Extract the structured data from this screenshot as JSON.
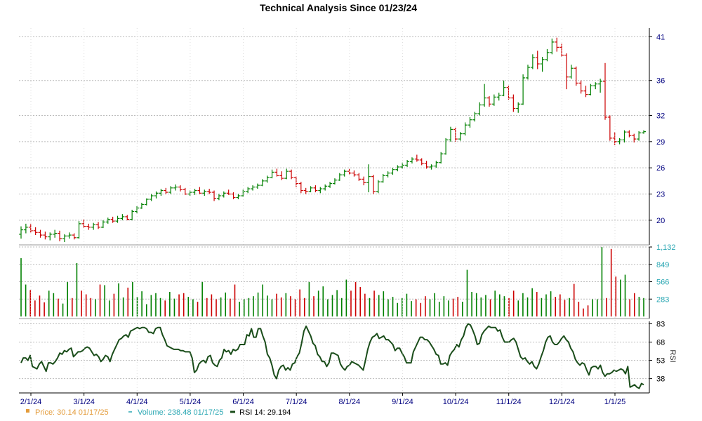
{
  "chart_data": {
    "type": "candlestick",
    "title": "Technical Analysis Since 01/23/24",
    "x_tick_labels": [
      "2/1/24",
      "3/1/24",
      "4/1/24",
      "5/1/24",
      "6/1/24",
      "7/1/24",
      "8/1/24",
      "9/1/24",
      "10/1/24",
      "11/1/24",
      "12/1/24",
      "1/1/25"
    ],
    "grid": true,
    "colors": {
      "up": "#008000",
      "down": "#cc0000",
      "rsi": "#1a4d1a",
      "price_legend": "#e39b3a",
      "volume_legend": "#2aa7b3",
      "grid": "#bbbbbb"
    },
    "price_panel": {
      "y_ticks": [
        20,
        23,
        26,
        29,
        32,
        36,
        41
      ],
      "ylim": [
        17.5,
        42
      ],
      "axis_color": "#000080",
      "ohlc": [
        [
          18.4,
          19.3,
          17.9,
          18.9
        ],
        [
          18.9,
          19.6,
          18.5,
          19.2
        ],
        [
          19.2,
          19.6,
          18.6,
          18.8
        ],
        [
          18.8,
          19.2,
          18.3,
          18.6
        ],
        [
          18.6,
          18.9,
          18.0,
          18.3
        ],
        [
          18.3,
          18.7,
          17.8,
          18.1
        ],
        [
          18.1,
          18.6,
          17.7,
          18.4
        ],
        [
          18.4,
          18.9,
          18.0,
          18.5
        ],
        [
          18.5,
          18.8,
          17.6,
          17.9
        ],
        [
          17.9,
          18.4,
          17.5,
          18.2
        ],
        [
          18.2,
          18.6,
          17.9,
          18.3
        ],
        [
          18.3,
          18.5,
          17.8,
          18.0
        ],
        [
          18.0,
          19.9,
          17.9,
          19.6
        ],
        [
          19.6,
          20.1,
          19.1,
          19.3
        ],
        [
          19.3,
          19.6,
          18.9,
          19.2
        ],
        [
          19.2,
          19.7,
          18.9,
          19.5
        ],
        [
          19.5,
          19.8,
          19.0,
          19.2
        ],
        [
          19.2,
          20.0,
          19.1,
          19.8
        ],
        [
          19.8,
          20.3,
          19.6,
          20.1
        ],
        [
          20.1,
          20.4,
          19.7,
          19.9
        ],
        [
          19.9,
          20.5,
          19.7,
          20.2
        ],
        [
          20.2,
          20.7,
          20.0,
          20.4
        ],
        [
          20.4,
          20.6,
          20.0,
          20.1
        ],
        [
          20.1,
          21.2,
          20.0,
          21.0
        ],
        [
          21.0,
          21.6,
          20.8,
          21.4
        ],
        [
          21.4,
          22.0,
          21.3,
          21.8
        ],
        [
          21.8,
          22.5,
          21.7,
          22.4
        ],
        [
          22.4,
          23.0,
          22.2,
          22.8
        ],
        [
          22.8,
          23.3,
          22.5,
          23.1
        ],
        [
          23.1,
          23.6,
          22.8,
          23.4
        ],
        [
          23.4,
          23.7,
          23.0,
          23.2
        ],
        [
          23.2,
          23.9,
          23.0,
          23.7
        ],
        [
          23.7,
          24.1,
          23.4,
          23.8
        ],
        [
          23.8,
          24.0,
          23.3,
          23.5
        ],
        [
          23.5,
          23.7,
          22.9,
          23.0
        ],
        [
          23.0,
          23.4,
          22.8,
          23.2
        ],
        [
          23.2,
          23.6,
          22.9,
          23.4
        ],
        [
          23.4,
          23.8,
          23.0,
          23.1
        ],
        [
          23.1,
          23.5,
          22.8,
          23.3
        ],
        [
          23.3,
          23.6,
          23.0,
          23.2
        ],
        [
          23.2,
          23.4,
          22.2,
          22.5
        ],
        [
          22.5,
          23.0,
          22.3,
          22.8
        ],
        [
          22.8,
          23.3,
          22.6,
          23.1
        ],
        [
          23.1,
          23.5,
          22.9,
          23.0
        ],
        [
          23.0,
          23.2,
          22.4,
          22.6
        ],
        [
          22.6,
          23.0,
          22.4,
          22.8
        ],
        [
          22.8,
          23.5,
          22.7,
          23.3
        ],
        [
          23.3,
          23.8,
          23.1,
          23.6
        ],
        [
          23.6,
          24.0,
          23.4,
          23.8
        ],
        [
          23.8,
          24.2,
          23.6,
          24.0
        ],
        [
          24.0,
          24.7,
          23.9,
          24.5
        ],
        [
          24.5,
          25.1,
          24.3,
          24.9
        ],
        [
          24.9,
          25.8,
          24.8,
          25.5
        ],
        [
          25.5,
          25.9,
          25.0,
          25.1
        ],
        [
          25.1,
          25.6,
          24.6,
          24.8
        ],
        [
          24.8,
          25.9,
          24.7,
          25.6
        ],
        [
          25.6,
          25.8,
          24.7,
          24.9
        ],
        [
          24.9,
          25.0,
          23.8,
          24.2
        ],
        [
          24.2,
          24.4,
          23.1,
          23.4
        ],
        [
          23.4,
          23.7,
          23.0,
          23.3
        ],
        [
          23.3,
          23.9,
          23.2,
          23.7
        ],
        [
          23.7,
          24.0,
          23.2,
          23.4
        ],
        [
          23.4,
          23.8,
          23.1,
          23.6
        ],
        [
          23.6,
          24.1,
          23.4,
          23.9
        ],
        [
          23.9,
          24.4,
          23.7,
          24.2
        ],
        [
          24.2,
          24.8,
          24.1,
          24.6
        ],
        [
          24.6,
          25.4,
          24.5,
          25.2
        ],
        [
          25.2,
          25.8,
          25.0,
          25.6
        ],
        [
          25.6,
          25.9,
          25.2,
          25.4
        ],
        [
          25.4,
          25.7,
          25.0,
          25.2
        ],
        [
          25.2,
          25.4,
          24.5,
          24.7
        ],
        [
          24.7,
          25.0,
          24.0,
          24.3
        ],
        [
          24.3,
          26.4,
          23.2,
          25.0
        ],
        [
          25.0,
          25.2,
          23.0,
          23.3
        ],
        [
          23.3,
          24.6,
          23.1,
          24.4
        ],
        [
          24.4,
          25.3,
          24.3,
          25.1
        ],
        [
          25.1,
          25.6,
          24.9,
          25.4
        ],
        [
          25.4,
          26.0,
          25.2,
          25.8
        ],
        [
          25.8,
          26.3,
          25.6,
          26.1
        ],
        [
          26.1,
          26.6,
          25.9,
          26.3
        ],
        [
          26.3,
          26.9,
          26.1,
          26.7
        ],
        [
          26.7,
          27.2,
          26.5,
          27.0
        ],
        [
          27.0,
          27.5,
          26.7,
          26.9
        ],
        [
          26.9,
          27.1,
          26.3,
          26.5
        ],
        [
          26.5,
          26.8,
          25.9,
          26.1
        ],
        [
          26.1,
          26.4,
          25.8,
          26.2
        ],
        [
          26.2,
          26.8,
          26.0,
          26.6
        ],
        [
          26.6,
          27.8,
          26.5,
          27.6
        ],
        [
          27.6,
          29.4,
          27.5,
          29.2
        ],
        [
          29.2,
          30.7,
          29.0,
          30.4
        ],
        [
          30.4,
          30.6,
          29.0,
          29.3
        ],
        [
          29.3,
          30.1,
          29.1,
          29.9
        ],
        [
          29.9,
          31.2,
          29.7,
          30.9
        ],
        [
          30.9,
          31.8,
          30.6,
          31.5
        ],
        [
          31.5,
          32.4,
          31.3,
          32.2
        ],
        [
          32.2,
          33.5,
          32.0,
          33.2
        ],
        [
          33.2,
          35.6,
          33.0,
          34.0
        ],
        [
          34.0,
          34.2,
          33.0,
          33.3
        ],
        [
          33.3,
          34.4,
          33.1,
          34.1
        ],
        [
          34.1,
          34.6,
          33.7,
          34.3
        ],
        [
          34.3,
          36.0,
          34.2,
          35.2
        ],
        [
          35.2,
          35.4,
          33.8,
          34.0
        ],
        [
          34.0,
          34.4,
          32.4,
          32.8
        ],
        [
          32.8,
          33.5,
          32.3,
          33.3
        ],
        [
          33.3,
          36.7,
          33.2,
          36.3
        ],
        [
          36.3,
          37.8,
          36.1,
          37.5
        ],
        [
          37.5,
          39.0,
          37.3,
          38.6
        ],
        [
          38.6,
          39.4,
          37.3,
          37.9
        ],
        [
          37.9,
          38.7,
          37.0,
          38.4
        ],
        [
          38.4,
          39.6,
          38.2,
          39.2
        ],
        [
          39.2,
          40.8,
          39.0,
          40.4
        ],
        [
          40.4,
          40.9,
          39.3,
          39.8
        ],
        [
          39.8,
          40.2,
          38.7,
          38.9
        ],
        [
          38.9,
          39.1,
          35.0,
          36.4
        ],
        [
          36.4,
          37.8,
          36.2,
          37.4
        ],
        [
          37.4,
          37.6,
          35.4,
          35.7
        ],
        [
          35.7,
          36.0,
          34.5,
          34.8
        ],
        [
          34.8,
          35.4,
          34.1,
          34.4
        ],
        [
          34.4,
          35.6,
          34.3,
          35.4
        ],
        [
          35.4,
          35.8,
          35.0,
          35.6
        ],
        [
          35.6,
          36.2,
          34.6,
          35.9
        ],
        [
          35.9,
          38.0,
          31.5,
          31.8
        ],
        [
          31.8,
          32.0,
          29.1,
          29.4
        ],
        [
          29.4,
          30.1,
          28.6,
          29.0
        ],
        [
          29.0,
          29.4,
          28.7,
          29.2
        ],
        [
          29.2,
          30.3,
          28.9,
          30.1
        ],
        [
          30.1,
          30.3,
          29.5,
          29.7
        ],
        [
          29.7,
          29.9,
          28.9,
          29.3
        ],
        [
          29.3,
          30.2,
          29.1,
          30.0
        ],
        [
          30.0,
          30.3,
          29.9,
          30.14
        ]
      ]
    },
    "volume_panel": {
      "y_ticks": [
        283,
        566,
        849,
        1132
      ],
      "y_tick_labels": [
        "283",
        "566",
        "849",
        "1,132"
      ],
      "ylim": [
        0,
        1132
      ],
      "axis_color": "#2aa7b3",
      "values": [
        950,
        520,
        430,
        260,
        340,
        230,
        420,
        380,
        290,
        210,
        560,
        300,
        870,
        420,
        360,
        300,
        280,
        520,
        510,
        260,
        370,
        540,
        310,
        470,
        560,
        320,
        410,
        200,
        350,
        380,
        300,
        260,
        400,
        290,
        360,
        380,
        320,
        280,
        240,
        560,
        300,
        360,
        280,
        310,
        390,
        290,
        520,
        240,
        280,
        300,
        330,
        390,
        520,
        340,
        280,
        370,
        310,
        380,
        330,
        280,
        440,
        300,
        560,
        330,
        420,
        490,
        280,
        350,
        430,
        300,
        600,
        420,
        560,
        480,
        370,
        300,
        420,
        350,
        410,
        280,
        320,
        220,
        300,
        370,
        250,
        280,
        220,
        330,
        280,
        380,
        240,
        330,
        260,
        290,
        320,
        240,
        760,
        400,
        380,
        310,
        350,
        280,
        420,
        360,
        330,
        300,
        420,
        260,
        380,
        310,
        460,
        400,
        300,
        360,
        410,
        320,
        360,
        270,
        300,
        530,
        240,
        130,
        180,
        280,
        280,
        1130,
        300,
        1100,
        650,
        600,
        680,
        280,
        380,
        320,
        300
      ]
    },
    "rsi_panel": {
      "y_ticks": [
        38,
        53,
        68,
        83
      ],
      "axis_label": "RSI",
      "axis_color": "#000000",
      "ylim": [
        28,
        85
      ],
      "values": [
        51,
        55,
        55,
        53,
        57,
        48,
        47,
        46,
        50,
        52,
        48,
        44,
        51,
        51,
        50,
        52,
        55,
        59,
        58,
        61,
        60,
        62,
        63,
        56,
        58,
        60,
        60,
        61,
        63,
        64,
        63,
        60,
        57,
        58,
        56,
        52,
        54,
        57,
        56,
        52,
        58,
        62,
        66,
        70,
        71,
        73,
        74,
        72,
        77,
        78,
        79,
        80,
        79,
        80,
        80,
        79,
        76,
        76,
        75,
        79,
        80,
        80,
        74,
        70,
        65,
        64,
        63,
        62,
        62,
        62,
        61,
        61,
        60,
        60,
        60,
        55,
        43,
        45,
        50,
        52,
        53,
        51,
        56,
        57,
        51,
        49,
        48,
        53,
        55,
        62,
        60,
        61,
        58,
        62,
        61,
        62,
        66,
        66,
        66,
        74,
        73,
        79,
        72,
        72,
        79,
        79,
        73,
        68,
        58,
        55,
        49,
        41,
        38,
        45,
        48,
        49,
        45,
        47,
        45,
        50,
        51,
        56,
        59,
        67,
        77,
        81,
        77,
        73,
        67,
        65,
        58,
        56,
        52,
        52,
        48,
        51,
        59,
        59,
        58,
        57,
        50,
        47,
        45,
        48,
        49,
        52,
        51,
        50,
        49,
        47,
        45,
        53,
        62,
        68,
        72,
        73,
        75,
        71,
        72,
        73,
        70,
        70,
        68,
        66,
        61,
        63,
        63,
        59,
        56,
        51,
        51,
        51,
        60,
        64,
        68,
        72,
        72,
        70,
        70,
        68,
        65,
        62,
        58,
        57,
        50,
        50,
        51,
        49,
        57,
        60,
        62,
        66,
        64,
        70,
        73,
        80,
        83,
        82,
        78,
        73,
        66,
        67,
        74,
        77,
        79,
        81,
        80,
        80,
        80,
        77,
        78,
        72,
        68,
        68,
        68,
        70,
        71,
        68,
        62,
        56,
        54,
        55,
        52,
        50,
        52,
        48,
        46,
        50,
        56,
        61,
        68,
        72,
        73,
        68,
        66,
        66,
        68,
        71,
        73,
        70,
        68,
        63,
        60,
        54,
        51,
        49,
        51,
        50,
        45,
        41,
        47,
        48,
        48,
        46,
        49,
        43,
        40,
        42,
        42,
        43,
        45,
        44,
        45,
        46,
        45,
        42,
        48,
        31,
        32,
        33,
        31,
        30,
        34,
        33
      ]
    },
    "legend": [
      {
        "label": "Price: 30.14  01/17/25",
        "color": "#e39b3a",
        "marker": "square"
      },
      {
        "label": "Volume: 238.48  01/17/25",
        "color": "#2aa7b3",
        "marker": "dash"
      },
      {
        "label": "RSI 14: 29.194",
        "color": "#1a4d1a",
        "marker": "line"
      }
    ]
  }
}
